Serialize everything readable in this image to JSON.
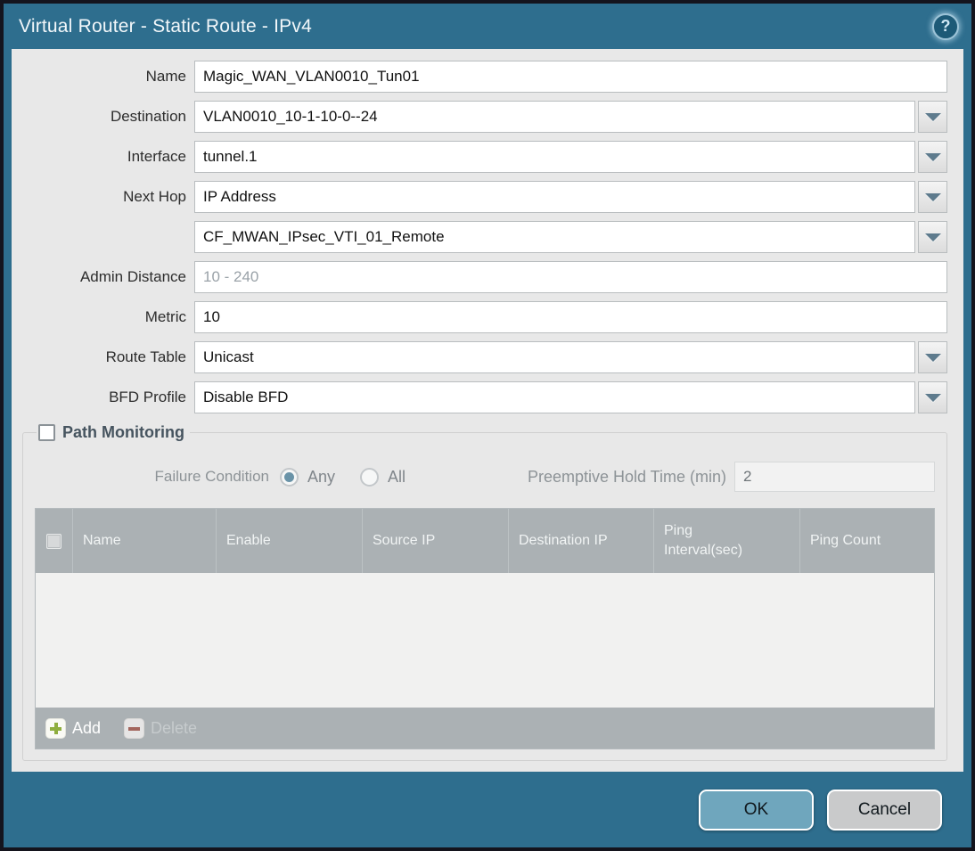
{
  "window": {
    "title": "Virtual Router - Static Route - IPv4",
    "help_glyph": "?"
  },
  "form": {
    "rows": [
      {
        "label": "Name",
        "value": "Magic_WAN_VLAN0010_Tun01",
        "type": "text"
      },
      {
        "label": "Destination",
        "value": "VLAN0010_10-1-10-0--24",
        "type": "combo"
      },
      {
        "label": "Interface",
        "value": "tunnel.1",
        "type": "combo"
      },
      {
        "label": "Next Hop",
        "value": "IP Address",
        "type": "combo"
      },
      {
        "label": "",
        "value": "CF_MWAN_IPsec_VTI_01_Remote",
        "type": "combo"
      },
      {
        "label": "Admin Distance",
        "value": "",
        "placeholder": "10 - 240",
        "type": "text"
      },
      {
        "label": "Metric",
        "value": "10",
        "type": "text"
      },
      {
        "label": "Route Table",
        "value": "Unicast",
        "type": "combo"
      },
      {
        "label": "BFD Profile",
        "value": "Disable BFD",
        "type": "combo"
      }
    ]
  },
  "path_monitoring": {
    "legend": "Path Monitoring",
    "checkbox_checked": false,
    "failure_condition_label": "Failure Condition",
    "radio_any_label": "Any",
    "radio_any_selected": true,
    "radio_all_label": "All",
    "radio_all_selected": false,
    "preemptive_label": "Preemptive Hold Time (min)",
    "preemptive_value": "2",
    "table": {
      "columns": [
        "Name",
        "Enable",
        "Source IP",
        "Destination IP",
        "Ping Interval(sec)",
        "Ping Count"
      ],
      "rows": [],
      "add_label": "Add",
      "delete_label": "Delete"
    }
  },
  "footer": {
    "ok_label": "OK",
    "cancel_label": "Cancel"
  },
  "colors": {
    "chrome_teal": "#2e6e8e",
    "content_bg": "#e8e8e8",
    "table_header_gray": "#abb1b4",
    "ok_button_blue": "#6fa6bd",
    "add_plus_green": "#8fae3e",
    "delete_minus_red": "#a2584e"
  }
}
